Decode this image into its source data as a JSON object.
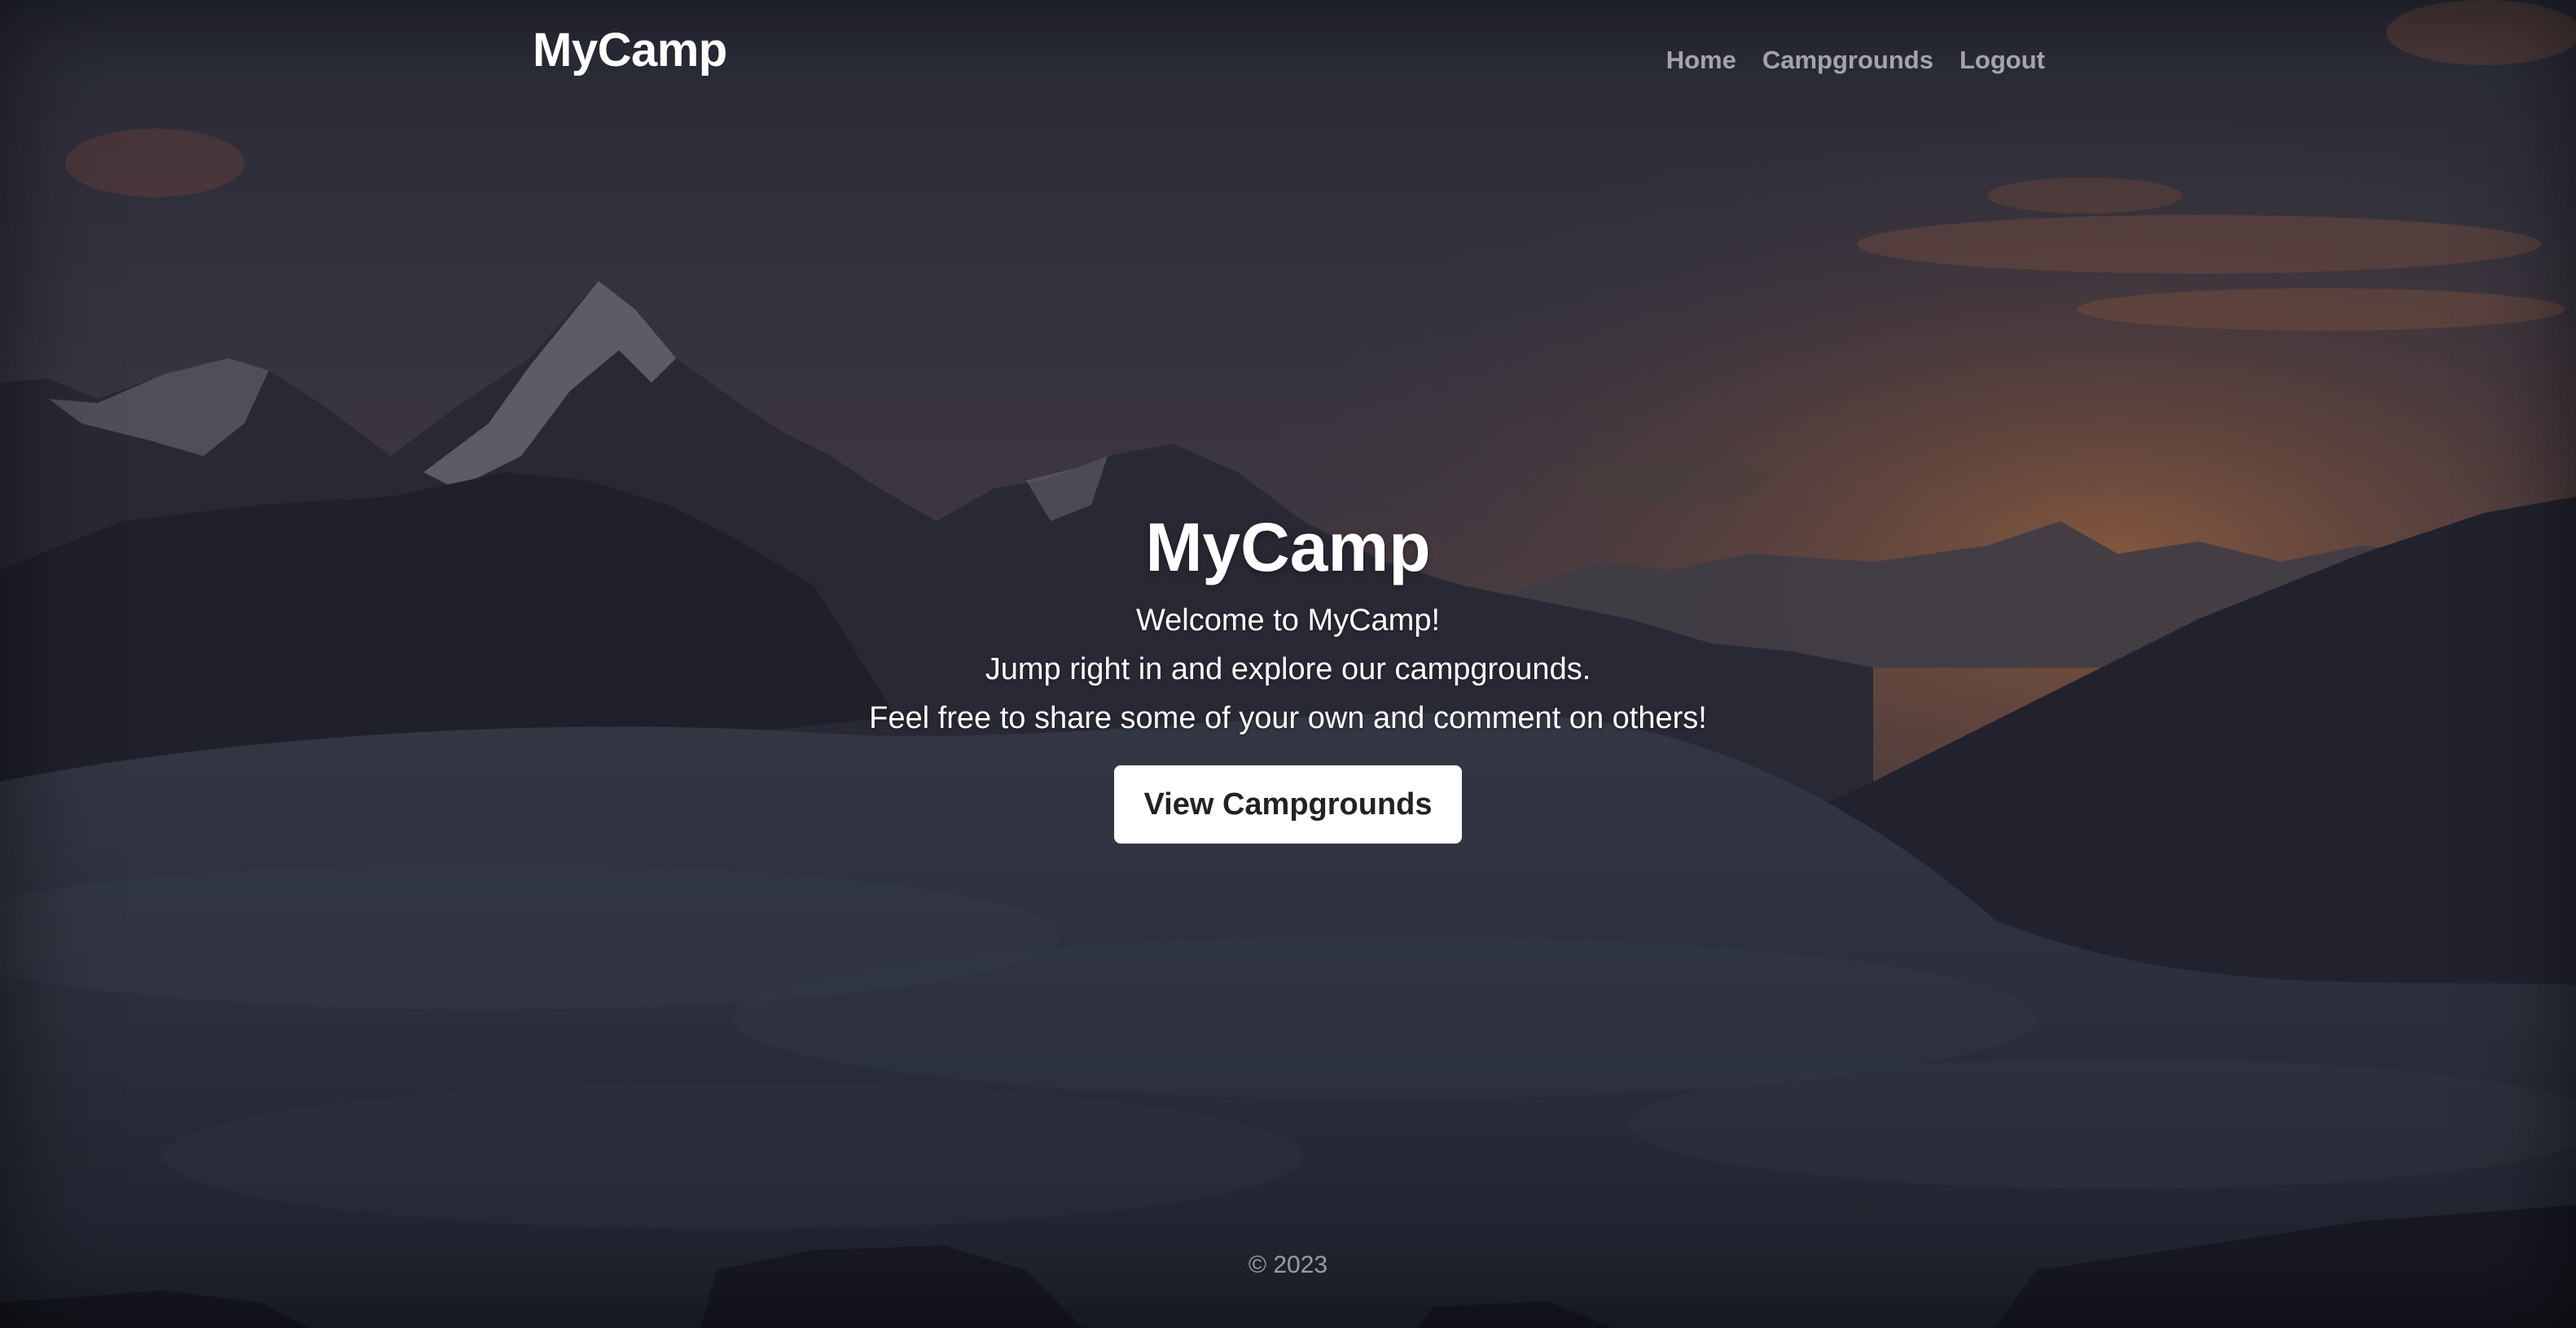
{
  "header": {
    "brand": "MyCamp",
    "nav": [
      {
        "label": "Home"
      },
      {
        "label": "Campgrounds"
      },
      {
        "label": "Logout"
      }
    ]
  },
  "hero": {
    "title": "MyCamp",
    "lines": [
      "Welcome to MyCamp!",
      "Jump right in and explore our campgrounds.",
      "Feel free to share some of your own and comment on others!"
    ],
    "cta_label": "View Campgrounds"
  },
  "footer": {
    "copyright": "© 2023"
  },
  "colors": {
    "text": "#ffffff",
    "nav_text": "rgba(255,255,255,0.58)",
    "button_bg": "#ffffff",
    "button_text": "#222222",
    "sky_top": "#3b3d4b",
    "sunset": "#c27a52",
    "clouds": "#4a4f5d"
  },
  "background": {
    "icon": "mountain-landscape-image"
  }
}
